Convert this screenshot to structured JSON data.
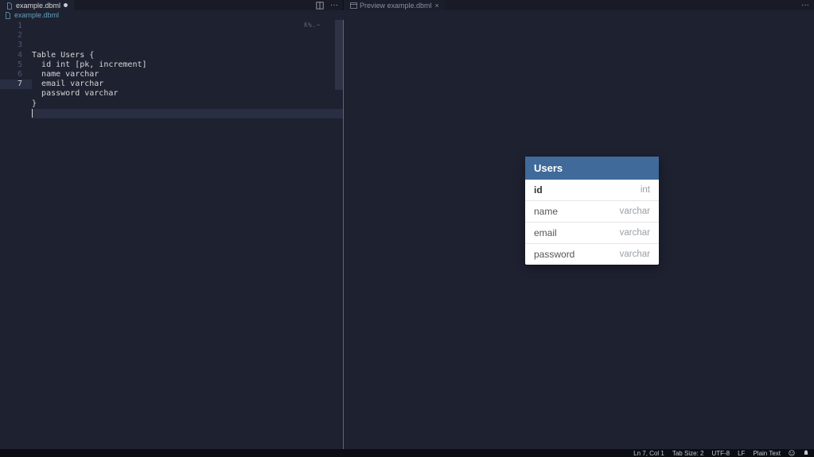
{
  "tabs": {
    "left": {
      "filename": "example.dbml",
      "dirty": true
    },
    "right": {
      "label": "Preview example.dbml"
    }
  },
  "open_editors": {
    "filename": "example.dbml"
  },
  "lens": "ƛ%.~",
  "editor": {
    "lines": [
      "Table Users {",
      "  id int [pk, increment]",
      "  name varchar",
      "  email varchar",
      "  password varchar",
      "}",
      ""
    ],
    "current_line_index": 6
  },
  "preview_table": {
    "name": "Users",
    "columns": [
      {
        "name": "id",
        "type": "int",
        "pk": true
      },
      {
        "name": "name",
        "type": "varchar",
        "pk": false
      },
      {
        "name": "email",
        "type": "varchar",
        "pk": false
      },
      {
        "name": "password",
        "type": "varchar",
        "pk": false
      }
    ]
  },
  "statusbar": {
    "cursor": "Ln 7, Col 1",
    "tab_size": "Tab Size: 2",
    "encoding": "UTF-8",
    "eol": "LF",
    "language": "Plain Text"
  }
}
